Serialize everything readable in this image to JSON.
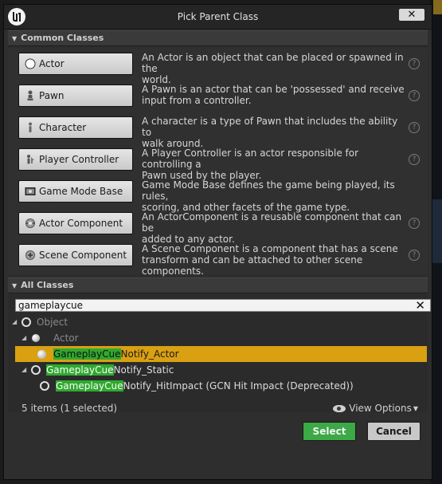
{
  "window": {
    "title": "Pick Parent Class",
    "close_label": "✕"
  },
  "common": {
    "header": "Common Classes",
    "items": [
      {
        "label": "Actor",
        "desc1": "An Actor is an object that can be placed or spawned in the",
        "desc2": "world."
      },
      {
        "label": "Pawn",
        "desc1": "A Pawn is an actor that can be 'possessed' and receive",
        "desc2": "input from a controller."
      },
      {
        "label": "Character",
        "desc1": "A character is a type of Pawn that includes the ability to",
        "desc2": "walk around."
      },
      {
        "label": "Player Controller",
        "desc1": "A Player Controller is an actor responsible for controlling a",
        "desc2": "Pawn used by the player."
      },
      {
        "label": "Game Mode Base",
        "desc1": "Game Mode Base defines the game being played, its rules,",
        "desc2": "scoring, and other facets of the game type."
      },
      {
        "label": "Actor Component",
        "desc1": "An ActorComponent is a reusable component that can be",
        "desc2": "added to any actor."
      },
      {
        "label": "Scene Component",
        "desc1": "A Scene Component is a component that has a scene",
        "desc2": "transform and can be attached to other scene components."
      }
    ],
    "help_glyph": "?"
  },
  "all_classes": {
    "header": "All Classes",
    "search": {
      "value": "gameplaycue",
      "clear": "✕"
    },
    "tree": {
      "object": "Object",
      "actor": "Actor",
      "notify_actor": {
        "match": "GameplayCue",
        "rest": "Notify_Actor"
      },
      "notify_static": {
        "match": "GameplayCue",
        "rest": "Notify_Static"
      },
      "notify_hitimpact": {
        "match": "GameplayCue",
        "rest": "Notify_HitImpact (GCN Hit Impact (Deprecated))"
      }
    },
    "status": "5 items (1 selected)",
    "view_options": "View Options"
  },
  "actions": {
    "select": "Select",
    "cancel": "Cancel"
  },
  "colors": {
    "highlight": "#2fa92f",
    "selection": "#d9a012",
    "select_button": "#3da846"
  },
  "icons": [
    "unreal-logo-icon",
    "close-icon",
    "actor-icon",
    "pawn-icon",
    "character-icon",
    "player-controller-icon",
    "game-mode-icon",
    "actor-component-icon",
    "scene-component-icon",
    "help-icon",
    "eye-icon",
    "chevron-down-icon"
  ]
}
